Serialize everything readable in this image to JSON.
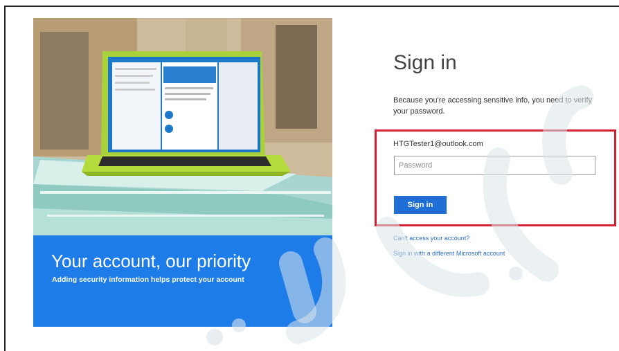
{
  "hero": {
    "title": "Your account, our priority",
    "subtitle": "Adding security information helps protect your account"
  },
  "signin": {
    "title": "Sign in",
    "description": "Because you're accessing sensitive info, you need to verify your password.",
    "email": "HTGTester1@outlook.com",
    "password_placeholder": "Password",
    "button_label": "Sign in",
    "link_cant_access": "Can't access your account?",
    "link_different_account": "Sign in with a different Microsoft account"
  },
  "colors": {
    "banner_blue": "#1e7ce8",
    "button_blue": "#1f6fd6",
    "link_blue": "#2a6fc9",
    "highlight_red": "#d42035"
  }
}
